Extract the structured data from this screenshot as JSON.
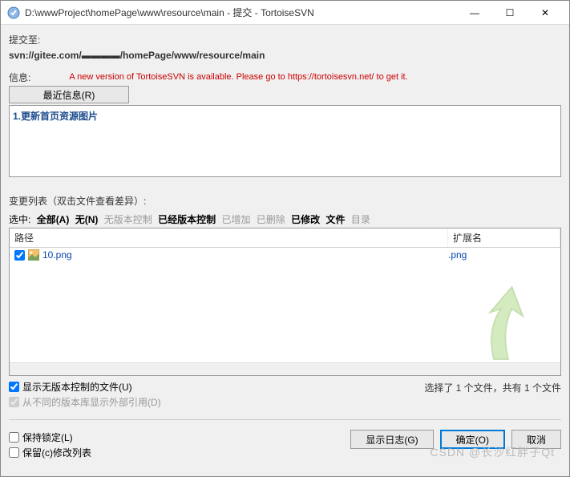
{
  "title": "D:\\wwwProject\\homePage\\www\\resource\\main - 提交 - TortoiseSVN",
  "commit_to_label": "提交至:",
  "repo_url": "svn://gitee.com/▬▬▬▬/homePage/www/resource/main",
  "msg_label": "信息:",
  "update_notice": "A new version of TortoiseSVN is available. Please go to https://tortoisesvn.net/ to get it.",
  "recent_btn": "最近信息(R)",
  "commit_msg": "1.更新首页资源图片",
  "changelist_label": "变更列表（双击文件查看差异）:",
  "filter": {
    "selected": "选中:",
    "all": "全部(A)",
    "none": "无(N)",
    "unversioned": "无版本控制",
    "versioned": "已经版本控制",
    "added": "已增加",
    "deleted": "已删除",
    "modified": "已修改",
    "files": "文件",
    "dirs": "目录"
  },
  "columns": {
    "path": "路径",
    "ext": "扩展名"
  },
  "files": [
    {
      "checked": true,
      "name": "10.png",
      "ext": ".png"
    }
  ],
  "opt_show_unversioned": "显示无版本控制的文件(U)",
  "opt_show_externals": "从不同的版本库显示外部引用(D)",
  "status_text": "选择了 1 个文件，共有 1 个文件",
  "opt_keep_locks": "保持锁定(L)",
  "opt_keep_changelist": "保留(c)修改列表",
  "btn_showlog": "显示日志(G)",
  "btn_ok": "确定(O)",
  "btn_cancel": "取消",
  "watermark": "CSDN @长沙红胖子Qt"
}
